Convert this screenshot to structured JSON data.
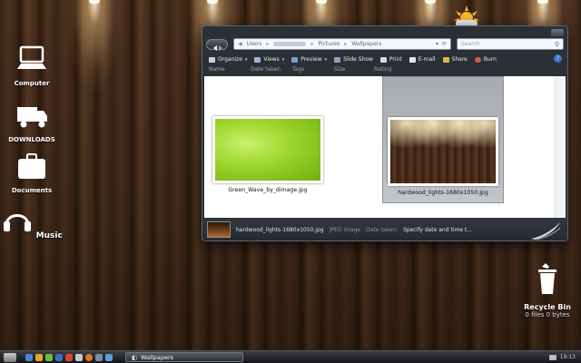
{
  "desktop": {
    "icons": [
      {
        "label": "Computer"
      },
      {
        "label": "DOWNLOADS"
      },
      {
        "label": "Documents"
      },
      {
        "label": "Music"
      }
    ],
    "recycle_bin": {
      "label": "Recycle Bin",
      "status": "0 files 0 bytes"
    }
  },
  "window": {
    "address": {
      "segments": [
        "Users",
        "Pictures",
        "Wallpapers"
      ]
    },
    "search_placeholder": "Search",
    "toolbar": {
      "organize": "Organize",
      "views": "Views",
      "preview": "Preview",
      "slideshow": "Slide Show",
      "print": "Print",
      "email": "E-mail",
      "share": "Share",
      "burn": "Burn"
    },
    "columns": [
      "Name",
      "Date taken",
      "Tags",
      "Size",
      "Rating"
    ],
    "files": [
      {
        "name": "Green_Wave_by_dimage.jpg"
      },
      {
        "name": "hardwood_lights-1680x1050.jpg"
      }
    ],
    "details": {
      "filename": "hardwood_lights-1680x1050.jpg",
      "type": "JPEG image",
      "date_label": "Date taken:",
      "date_value": "Specify date and time t..."
    }
  },
  "taskbar": {
    "task_label": "Wallpapers",
    "clock": "19:13"
  },
  "colors": {
    "accent": "#3f72c8",
    "window_frame": "#2b2f36"
  }
}
